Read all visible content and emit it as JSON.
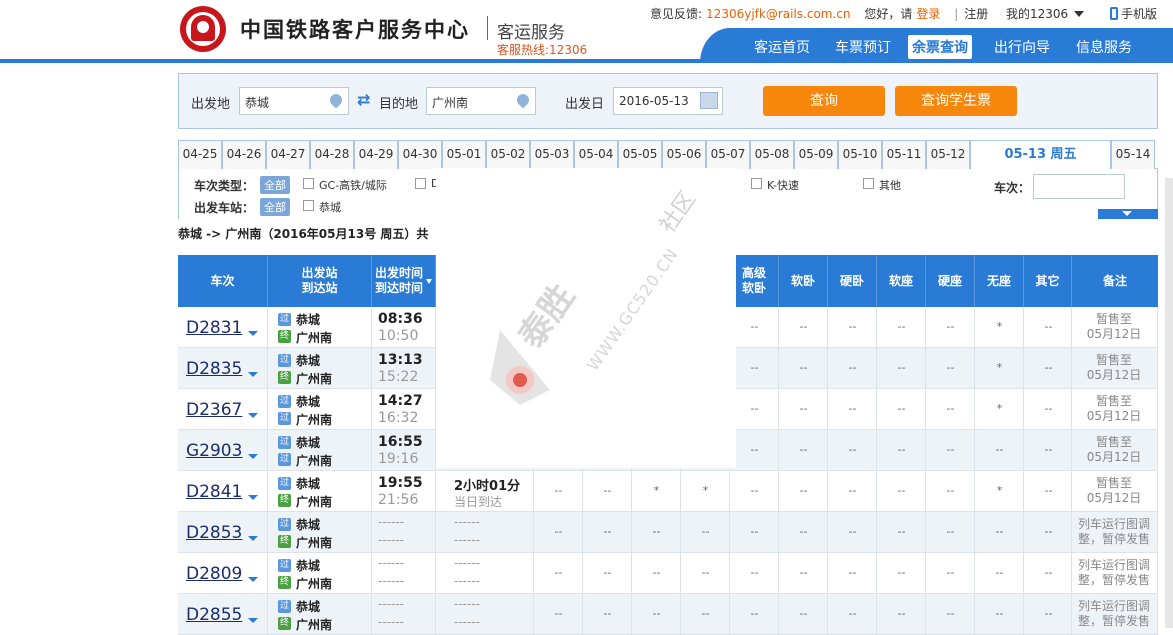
{
  "header": {
    "site_title": "中国铁路客户服务中心",
    "service_title": "客运服务",
    "hotline": "客服热线:12306",
    "feedback_label": "意见反馈:",
    "feedback_email": "12306yjfk@rails.com.cn",
    "greeting": "您好，请",
    "login": "登录",
    "separator": "|",
    "register": "注册",
    "my_account": "我的12306",
    "mobile": "手机版"
  },
  "nav": {
    "items": [
      "客运首页",
      "车票预订",
      "余票查询",
      "出行向导",
      "信息服务"
    ],
    "active_index": 2
  },
  "search": {
    "from_label": "出发地",
    "from_value": "恭城",
    "to_label": "目的地",
    "to_value": "广州南",
    "date_label": "出发日",
    "date_value": "2016-05-13",
    "query_button": "查询",
    "student_button": "查询学生票"
  },
  "date_tabs": [
    "04-25",
    "04-26",
    "04-27",
    "04-28",
    "04-29",
    "04-30",
    "05-01",
    "05-02",
    "05-03",
    "05-04",
    "05-05",
    "05-06",
    "05-07",
    "05-08",
    "05-09",
    "05-10",
    "05-11",
    "05-12",
    "05-13 周五",
    "05-14"
  ],
  "date_tabs_active": 18,
  "filters": {
    "train_type_label": "车次类型：",
    "station_label": "出发车站：",
    "all_label": "全部",
    "types": [
      "GC-高铁/城际",
      "D",
      "K-快速",
      "其他"
    ],
    "station_options": [
      "恭城"
    ],
    "train_no_label": "车次："
  },
  "route_summary": "恭城 -> 广州南（2016年05月13号  周五）共",
  "table": {
    "headers": {
      "train": "车次",
      "station": "出发站\n到达站",
      "time": "出发时间\n到达时间",
      "gaoji": "高级\n软卧",
      "ruanwo": "软卧",
      "yingwo": "硬卧",
      "ruanzuo": "软座",
      "yingzuo": "硬座",
      "wuzuo": "无座",
      "qita": "其它",
      "beizhu": "备注"
    },
    "pass_icon": "过",
    "end_icon": "终",
    "rows": [
      {
        "no": "D2831",
        "from": "恭城",
        "to": "广州南",
        "dep": "08:36",
        "arr": "10:50",
        "to_icon": "end",
        "wuzuo": "*",
        "note": "暂售至\n05月12日"
      },
      {
        "no": "D2835",
        "from": "恭城",
        "to": "广州南",
        "dep": "13:13",
        "arr": "15:22",
        "to_icon": "end",
        "wuzuo": "*",
        "note": "暂售至\n05月12日"
      },
      {
        "no": "D2367",
        "from": "恭城",
        "to": "广州南",
        "dep": "14:27",
        "arr": "16:32",
        "to_icon": "pass",
        "wuzuo": "*",
        "note": "暂售至\n05月12日"
      },
      {
        "no": "G2903",
        "from": "恭城",
        "to": "广州南",
        "dep": "16:55",
        "arr": "19:16",
        "to_icon": "pass",
        "wuzuo": "--",
        "note": "暂售至\n05月12日"
      },
      {
        "no": "D2841",
        "from": "恭城",
        "to": "广州南",
        "dep": "19:55",
        "arr": "21:56",
        "to_icon": "end",
        "duration": "2小时01分",
        "duration_note": "当日到达",
        "wuzuo": "*",
        "extra": [
          "--",
          "--",
          "*",
          "*"
        ],
        "note": "暂售至\n05月12日"
      },
      {
        "no": "D2853",
        "from": "恭城",
        "to": "广州南",
        "dep": "------",
        "arr": "------",
        "to_icon": "end",
        "duration": "------",
        "duration_note": "------",
        "wuzuo": "--",
        "extra": [
          "--",
          "--",
          "--",
          "--"
        ],
        "note": "列车运行图调\n整，暂停发售"
      },
      {
        "no": "D2809",
        "from": "恭城",
        "to": "广州南",
        "dep": "------",
        "arr": "------",
        "to_icon": "end",
        "duration": "------",
        "duration_note": "------",
        "wuzuo": "--",
        "extra": [
          "--",
          "--",
          "--",
          "--"
        ],
        "note": "列车运行图调\n整，暂停发售"
      },
      {
        "no": "D2855",
        "from": "恭城",
        "to": "广州南",
        "dep": "------",
        "arr": "------",
        "to_icon": "end",
        "duration": "------",
        "duration_note": "------",
        "wuzuo": "--",
        "extra": [
          "--",
          "--",
          "--",
          "--"
        ],
        "note": "列车运行图调\n整，暂停发售"
      }
    ],
    "dash": "--"
  },
  "watermark": {
    "text": "泰胜",
    "url": "WWW.GC520.CN",
    "she": "社区"
  },
  "colors": {
    "brand_blue": "#2a7bd6",
    "orange": "#f7870c",
    "logo_red": "#c8161d"
  }
}
